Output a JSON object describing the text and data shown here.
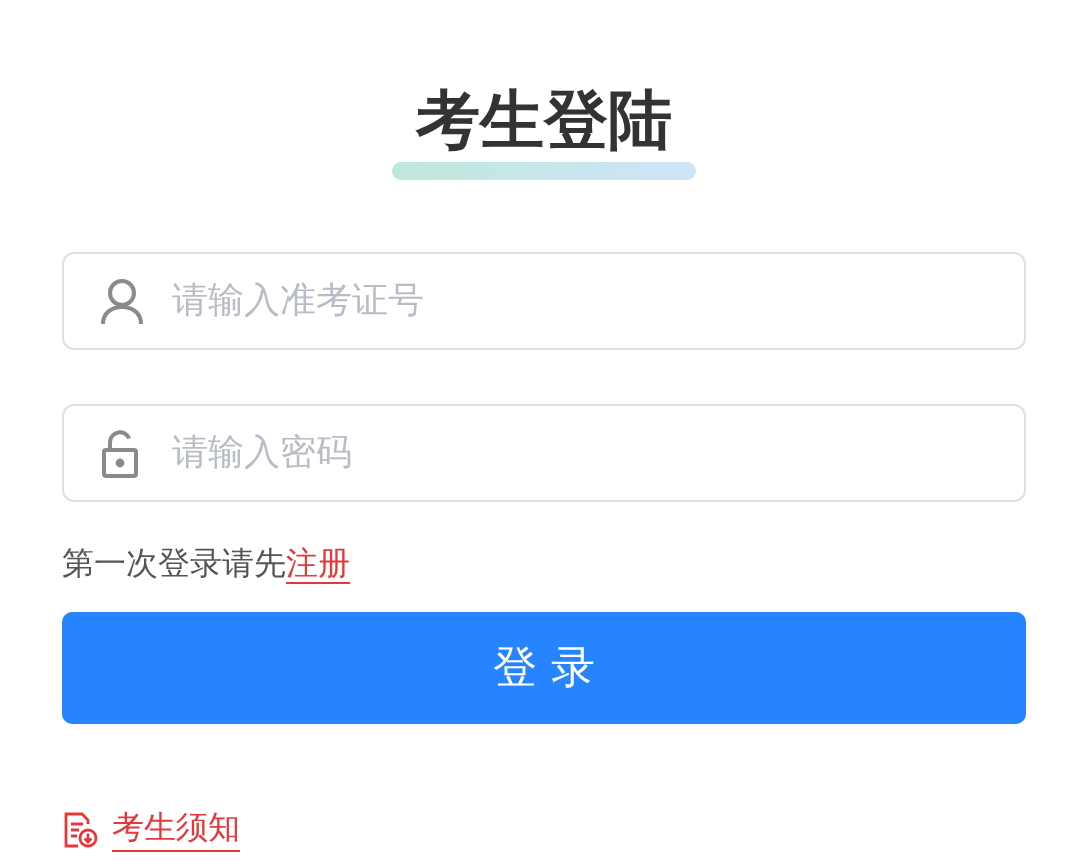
{
  "title": "考生登陆",
  "fields": [
    {
      "kind": "user",
      "placeholder": "请输入准考证号"
    },
    {
      "kind": "lock",
      "placeholder": "请输入密码"
    }
  ],
  "register": {
    "prompt": "第一次登录请先",
    "link": "注册"
  },
  "login_button": "登 录",
  "notice_link": "考生须知"
}
